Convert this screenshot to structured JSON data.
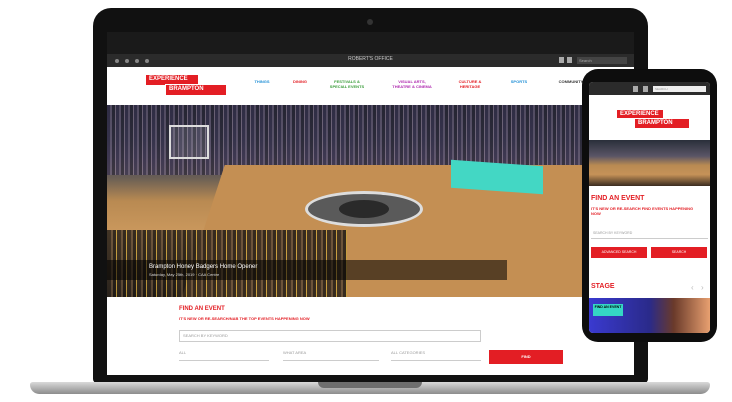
{
  "laptop": {
    "browser_title": "ROBERT'S OFFICE",
    "browser_search": "Search",
    "logo_line1": "EXPERIENCE",
    "logo_line2": "BRAMPTON",
    "nav": [
      {
        "label": "THINGS",
        "color": "#1f8fd6"
      },
      {
        "label": "DINING",
        "color": "#e31e24"
      },
      {
        "label": "FESTIVALS & SPECIAL EVENTS",
        "color": "#3a9d3a"
      },
      {
        "label": "VISUAL ARTS, THEATRE & CINEMA",
        "color": "#b02bb0"
      },
      {
        "label": "CULTURE & HERITAGE",
        "color": "#e31e24"
      },
      {
        "label": "SPORTS",
        "color": "#1f8fd6"
      },
      {
        "label": "COMMUNITY",
        "color": "#333333"
      }
    ],
    "hero_title": "Brampton Honey Badgers Home Opener",
    "hero_subtitle": "Saturday, May 25th, 2019  ·  CAA Centre",
    "find_title": "FIND AN EVENT",
    "find_subtitle": "IT'S NEW OR RE-SEARCH/NAB THE TOP EVENTS HAPPENING NOW",
    "search_placeholder": "SEARCH BY KEYWORD",
    "field1": "ALL",
    "field2": "WHAT AREA",
    "field3": "ALL CATEGORIES",
    "search_button": "FIND"
  },
  "phone": {
    "search": "SEARCH",
    "logo_line1": "EXPERIENCE",
    "logo_line2": "BRAMPTON",
    "find_title": "FIND AN EVENT",
    "find_subtitle": "IT'S NEW OR RE-SEARCH FIND EVENTS HAPPENING NOW",
    "search_placeholder": "SEARCH BY KEYWORD",
    "button_advanced": "ADVANCED SEARCH",
    "button_search": "SEARCH",
    "stage_title": "STAGE",
    "arrow_prev": "‹",
    "arrow_next": "›",
    "stage_tag": "FIND AN EVENT"
  },
  "colors": {
    "brand_red": "#e31e24",
    "teal": "#43d7c4"
  }
}
